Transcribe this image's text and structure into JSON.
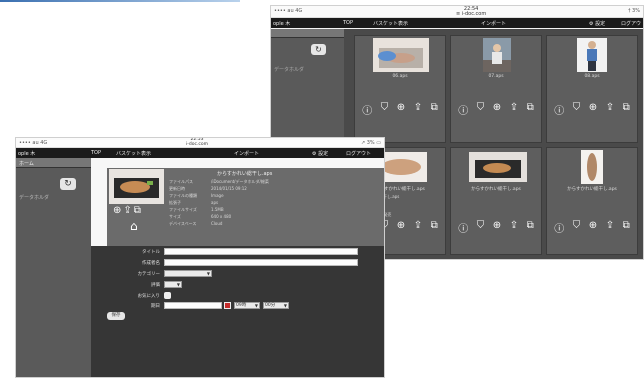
{
  "back": {
    "status": {
      "left": "•••• au 4G",
      "center_time": "22:54",
      "center_host": "≡ i-doc.com",
      "right": "† 3%"
    },
    "nav": {
      "home": "ople 木",
      "top": "TOP",
      "basket": "バスケット表示",
      "import": "インポート",
      "settings": "⚙ 設定",
      "logout": "ログアウ"
    },
    "side_path": "データホルダ",
    "cards": [
      {
        "name": "06.aps"
      },
      {
        "name": "07.aps"
      },
      {
        "name": "08.aps"
      },
      {
        "name": "からすかれい総干し.aps",
        "notes": [
          "し詰めかれい干し.aps",
          "お詰め合わせ",
          "冷凍保存で",
          "2014/01/15 発売"
        ]
      },
      {
        "name": "からすかれい総干し.aps"
      },
      {
        "name": "からすかれい総干し.aps"
      }
    ]
  },
  "front": {
    "status": {
      "left": "•••• au 4G",
      "center_time": "22:53",
      "center_host": "i-doc.com",
      "right": "↗ 3% ▭"
    },
    "nav": {
      "home": "ople 木",
      "top": "TOP",
      "basket": "バスケット表示",
      "import": "インポート",
      "settings": "⚙ 設定",
      "logout": "ログアウト"
    },
    "side_tab": "ホーム",
    "side_path": "データホルダ",
    "detail": {
      "title": "からすかれい総干し.aps",
      "meta": [
        {
          "k": "ファイルパス",
          "v": "/iDocument/データホルダ/総菜"
        },
        {
          "k": "更新日時",
          "v": "2014/01/15 09:12"
        },
        {
          "k": "ファイルの種類",
          "v": "Image"
        },
        {
          "k": "拡張子",
          "v": "aps"
        },
        {
          "k": "ファイルサイズ",
          "v": "1.5MB"
        },
        {
          "k": "サイズ",
          "v": "640 x 480"
        },
        {
          "k": "デバイスベース",
          "v": "Cloud"
        }
      ]
    },
    "form": {
      "title_label": "タイトル",
      "author_label": "作成者名",
      "category_label": "カテゴリー",
      "rating_label": "評価",
      "favorite_label": "お気に入り",
      "date_label": "期日",
      "hour_value": "09時",
      "minute_value": "00分",
      "save_label": "保存"
    }
  }
}
